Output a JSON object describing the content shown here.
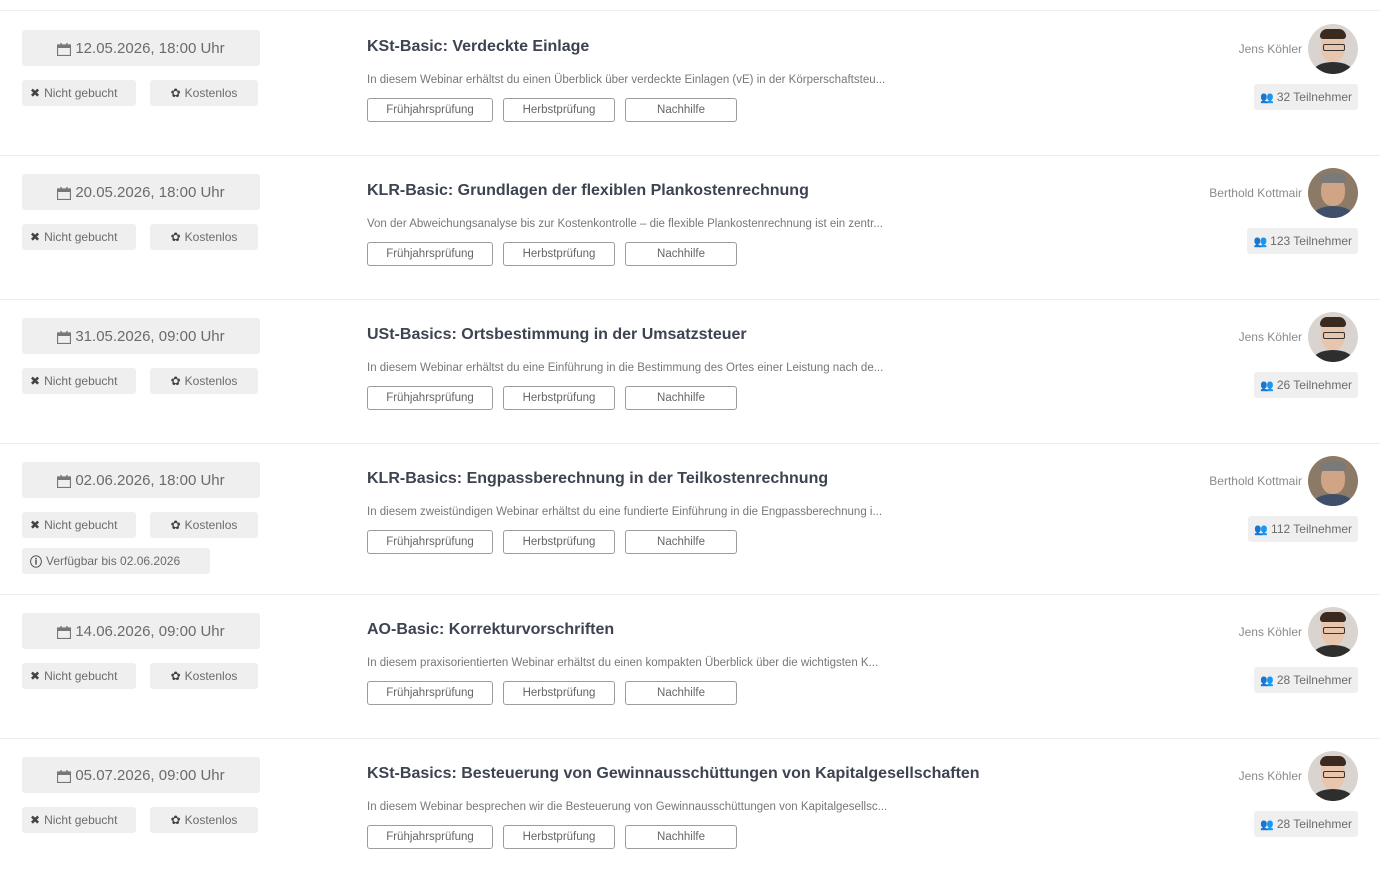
{
  "colors": {
    "badge_bg": "#efefef",
    "title": "#3d4350",
    "tag_border": "#9c9c9c"
  },
  "icons": {
    "calendar": "calendar-icon",
    "not_booked": "x-icon",
    "free": "gift-icon",
    "available": "info-icon",
    "participants": "users-icon"
  },
  "webinars": [
    {
      "date": "12.05.2026, 18:00 Uhr",
      "booking_status": "Nicht gebucht",
      "price": "Kostenlos",
      "available_until": "",
      "title": "KSt-Basic: Verdeckte Einlage",
      "description": "In diesem Webinar erhältst du einen Überblick über verdeckte Einlagen (vE) in der Körperschaftsteu...",
      "tags": [
        "Frühjahrsprüfung",
        "Herbstprüfung",
        "Nachhilfe"
      ],
      "instructor": "Jens Köhler",
      "participants": "32 Teilnehmer"
    },
    {
      "date": "20.05.2026, 18:00 Uhr",
      "booking_status": "Nicht gebucht",
      "price": "Kostenlos",
      "available_until": "",
      "title": "KLR-Basic: Grundlagen der flexiblen Plankostenrechnung",
      "description": "Von der Abweichungsanalyse bis zur Kostenkontrolle – die flexible Plankostenrechnung ist ein zentr...",
      "tags": [
        "Frühjahrsprüfung",
        "Herbstprüfung",
        "Nachhilfe"
      ],
      "instructor": "Berthold Kottmair",
      "participants": "123 Teilnehmer"
    },
    {
      "date": "31.05.2026, 09:00 Uhr",
      "booking_status": "Nicht gebucht",
      "price": "Kostenlos",
      "available_until": "",
      "title": "USt-Basics: Ortsbestimmung in der Umsatzsteuer",
      "description": "In diesem Webinar erhältst du eine Einführung in die Bestimmung des Ortes einer Leistung nach de...",
      "tags": [
        "Frühjahrsprüfung",
        "Herbstprüfung",
        "Nachhilfe"
      ],
      "instructor": "Jens Köhler",
      "participants": "26 Teilnehmer"
    },
    {
      "date": "02.06.2026, 18:00 Uhr",
      "booking_status": "Nicht gebucht",
      "price": "Kostenlos",
      "available_until": "Verfügbar bis 02.06.2026",
      "title": "KLR-Basics: Engpassberechnung in der Teilkostenrechnung",
      "description": "In diesem zweistündigen Webinar erhältst du eine fundierte Einführung in die Engpassberechnung i...",
      "tags": [
        "Frühjahrsprüfung",
        "Herbstprüfung",
        "Nachhilfe"
      ],
      "instructor": "Berthold Kottmair",
      "participants": "112 Teilnehmer"
    },
    {
      "date": "14.06.2026, 09:00 Uhr",
      "booking_status": "Nicht gebucht",
      "price": "Kostenlos",
      "available_until": "",
      "title": "AO-Basic: Korrekturvorschriften",
      "description": "In diesem praxisorientierten Webinar erhältst du einen kompakten Überblick über die wichtigsten K...",
      "tags": [
        "Frühjahrsprüfung",
        "Herbstprüfung",
        "Nachhilfe"
      ],
      "instructor": "Jens Köhler",
      "participants": "28 Teilnehmer"
    },
    {
      "date": "05.07.2026, 09:00 Uhr",
      "booking_status": "Nicht gebucht",
      "price": "Kostenlos",
      "available_until": "",
      "title": "KSt-Basics: Besteuerung von Gewinnausschüttungen von Kapitalgesellschaften",
      "description": "In diesem Webinar besprechen wir die Besteuerung von Gewinnausschüttungen von Kapitalgesellsc...",
      "tags": [
        "Frühjahrsprüfung",
        "Herbstprüfung",
        "Nachhilfe"
      ],
      "instructor": "Jens Köhler",
      "participants": "28 Teilnehmer"
    }
  ]
}
